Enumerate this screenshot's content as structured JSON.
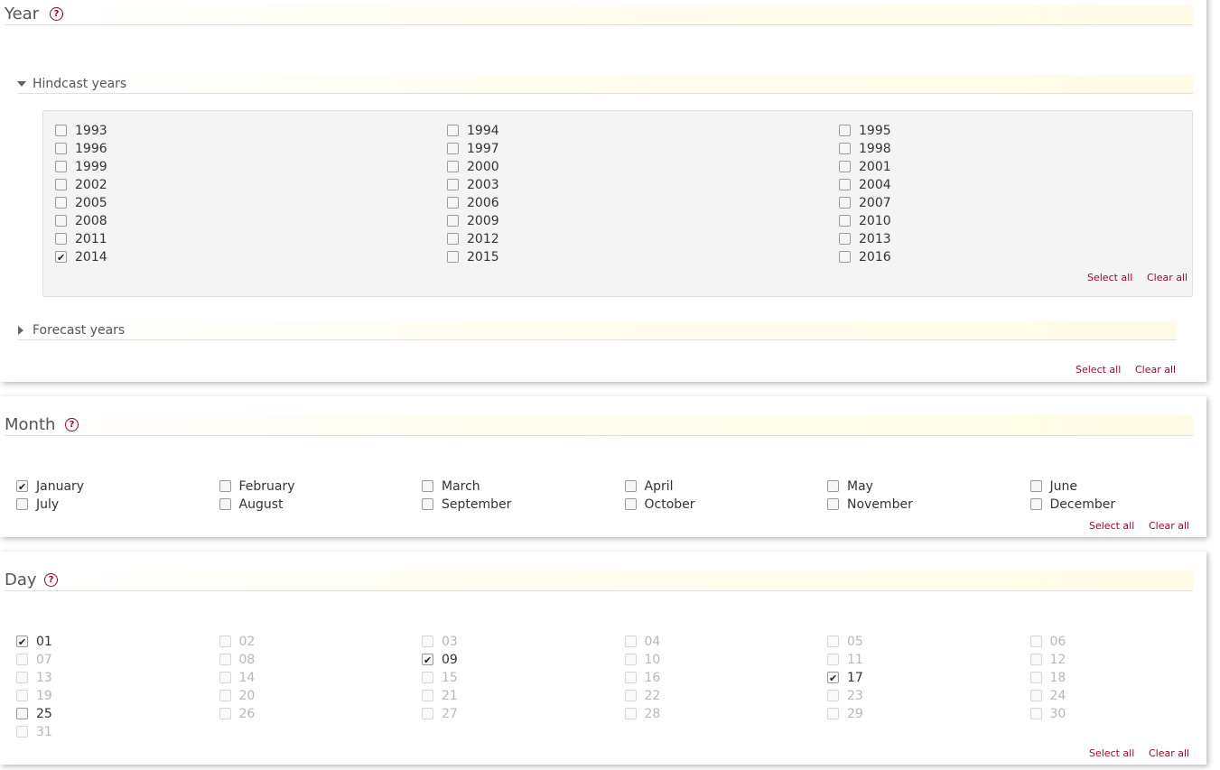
{
  "year": {
    "title": "Year",
    "hindcast": {
      "label": "Hindcast years",
      "years": [
        {
          "label": "1993",
          "checked": false
        },
        {
          "label": "1994",
          "checked": false
        },
        {
          "label": "1995",
          "checked": false
        },
        {
          "label": "1996",
          "checked": false
        },
        {
          "label": "1997",
          "checked": false
        },
        {
          "label": "1998",
          "checked": false
        },
        {
          "label": "1999",
          "checked": false
        },
        {
          "label": "2000",
          "checked": false
        },
        {
          "label": "2001",
          "checked": false
        },
        {
          "label": "2002",
          "checked": false
        },
        {
          "label": "2003",
          "checked": false
        },
        {
          "label": "2004",
          "checked": false
        },
        {
          "label": "2005",
          "checked": false
        },
        {
          "label": "2006",
          "checked": false
        },
        {
          "label": "2007",
          "checked": false
        },
        {
          "label": "2008",
          "checked": false
        },
        {
          "label": "2009",
          "checked": false
        },
        {
          "label": "2010",
          "checked": false
        },
        {
          "label": "2011",
          "checked": false
        },
        {
          "label": "2012",
          "checked": false
        },
        {
          "label": "2013",
          "checked": false
        },
        {
          "label": "2014",
          "checked": true
        },
        {
          "label": "2015",
          "checked": false
        },
        {
          "label": "2016",
          "checked": false
        }
      ],
      "select_all": "Select all",
      "clear_all": "Clear all"
    },
    "forecast": {
      "label": "Forecast years"
    },
    "select_all": "Select all",
    "clear_all": "Clear all"
  },
  "month": {
    "title": "Month",
    "months": [
      {
        "label": "January",
        "checked": true
      },
      {
        "label": "February",
        "checked": false
      },
      {
        "label": "March",
        "checked": false
      },
      {
        "label": "April",
        "checked": false
      },
      {
        "label": "May",
        "checked": false
      },
      {
        "label": "June",
        "checked": false
      },
      {
        "label": "July",
        "checked": false
      },
      {
        "label": "August",
        "checked": false
      },
      {
        "label": "September",
        "checked": false
      },
      {
        "label": "October",
        "checked": false
      },
      {
        "label": "November",
        "checked": false
      },
      {
        "label": "December",
        "checked": false
      }
    ],
    "select_all": "Select all",
    "clear_all": "Clear all"
  },
  "day": {
    "title": "Day",
    "days": [
      {
        "label": "01",
        "checked": true,
        "enabled": true
      },
      {
        "label": "02",
        "checked": false,
        "enabled": false
      },
      {
        "label": "03",
        "checked": false,
        "enabled": false
      },
      {
        "label": "04",
        "checked": false,
        "enabled": false
      },
      {
        "label": "05",
        "checked": false,
        "enabled": false
      },
      {
        "label": "06",
        "checked": false,
        "enabled": false
      },
      {
        "label": "07",
        "checked": false,
        "enabled": false
      },
      {
        "label": "08",
        "checked": false,
        "enabled": false
      },
      {
        "label": "09",
        "checked": true,
        "enabled": true
      },
      {
        "label": "10",
        "checked": false,
        "enabled": false
      },
      {
        "label": "11",
        "checked": false,
        "enabled": false
      },
      {
        "label": "12",
        "checked": false,
        "enabled": false
      },
      {
        "label": "13",
        "checked": false,
        "enabled": false
      },
      {
        "label": "14",
        "checked": false,
        "enabled": false
      },
      {
        "label": "15",
        "checked": false,
        "enabled": false
      },
      {
        "label": "16",
        "checked": false,
        "enabled": false
      },
      {
        "label": "17",
        "checked": true,
        "enabled": true
      },
      {
        "label": "18",
        "checked": false,
        "enabled": false
      },
      {
        "label": "19",
        "checked": false,
        "enabled": false
      },
      {
        "label": "20",
        "checked": false,
        "enabled": false
      },
      {
        "label": "21",
        "checked": false,
        "enabled": false
      },
      {
        "label": "22",
        "checked": false,
        "enabled": false
      },
      {
        "label": "23",
        "checked": false,
        "enabled": false
      },
      {
        "label": "24",
        "checked": false,
        "enabled": false
      },
      {
        "label": "25",
        "checked": false,
        "enabled": true
      },
      {
        "label": "26",
        "checked": false,
        "enabled": false
      },
      {
        "label": "27",
        "checked": false,
        "enabled": false
      },
      {
        "label": "28",
        "checked": false,
        "enabled": false
      },
      {
        "label": "29",
        "checked": false,
        "enabled": false
      },
      {
        "label": "30",
        "checked": false,
        "enabled": false
      },
      {
        "label": "31",
        "checked": false,
        "enabled": false
      }
    ],
    "select_all": "Select all",
    "clear_all": "Clear all"
  },
  "icons": {
    "help": "help-circle-icon",
    "expanded": "caret-down-icon",
    "collapsed": "caret-right-icon"
  },
  "colors": {
    "accent": "#9b0a2c",
    "title_text": "#555555",
    "disabled_text": "#b8b8b8",
    "box_bg": "#f4f4f4"
  }
}
